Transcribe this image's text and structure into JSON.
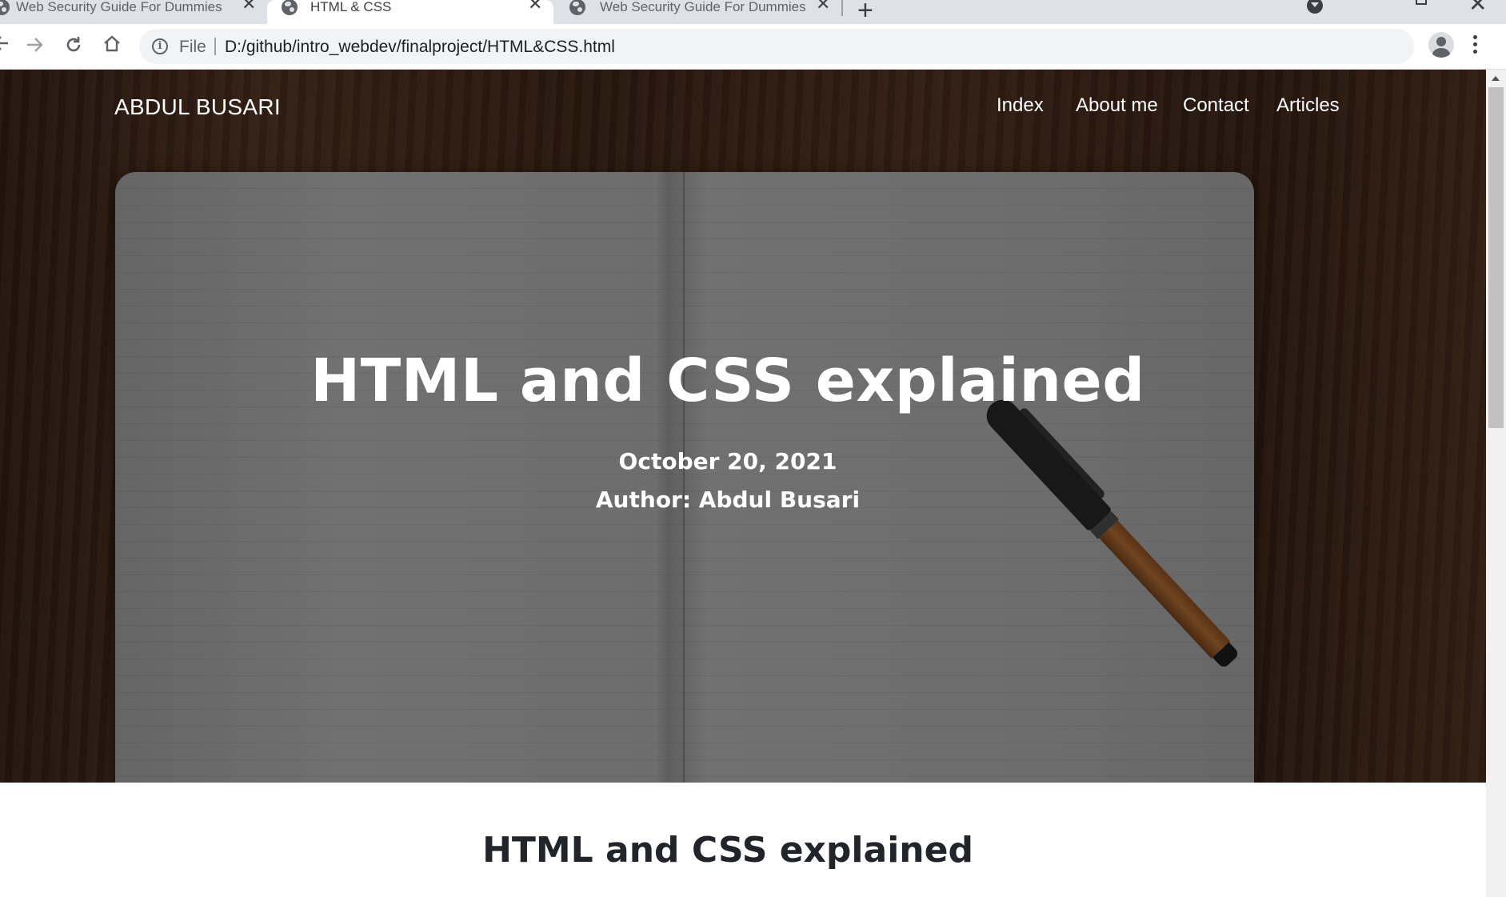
{
  "browser": {
    "tabs": [
      {
        "title": "Web Security Guide For Dummies",
        "active": false
      },
      {
        "title": "HTML & CSS",
        "active": true
      },
      {
        "title": "Web Security Guide For Dummies",
        "active": false
      }
    ],
    "new_tab_glyph": "+",
    "close_glyph": "✕",
    "address_bar": {
      "scheme_label": "File",
      "url": "D:/github/intro_webdev/finalproject/HTML&CSS.html"
    },
    "icons": {
      "back": "arrow-left-icon",
      "forward": "arrow-right-icon",
      "reload": "reload-icon",
      "home": "home-icon",
      "info": "info-icon",
      "bookmark": "star-icon",
      "profile": "avatar-icon",
      "menu": "kebab-menu-icon"
    }
  },
  "site": {
    "brand": "ABDUL BUSARI",
    "nav": [
      {
        "label": "Index"
      },
      {
        "label": "About me"
      },
      {
        "label": "Contact"
      },
      {
        "label": "Articles"
      }
    ]
  },
  "hero": {
    "title": "HTML and CSS explained",
    "date": "October 20, 2021",
    "author": "Author: Abdul Busari"
  },
  "content": {
    "title": "HTML and CSS explained"
  }
}
